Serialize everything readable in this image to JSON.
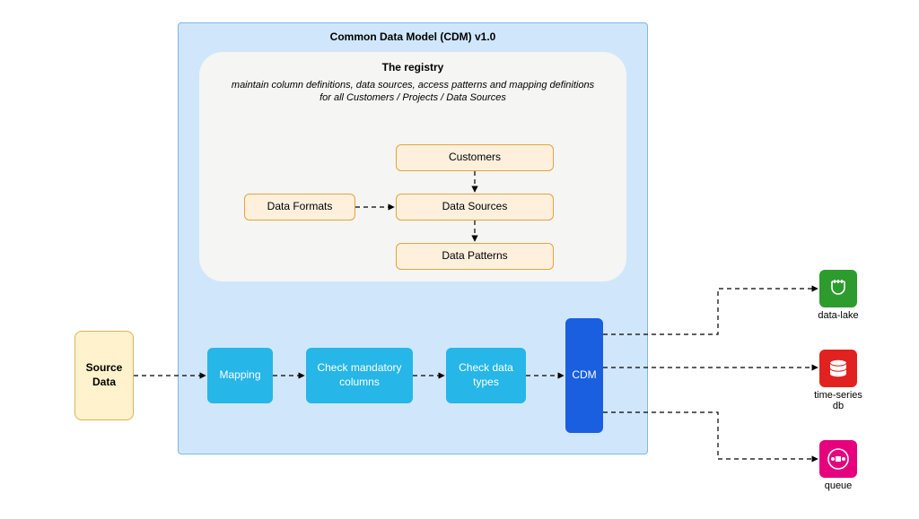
{
  "outerTitle": "Common Data Model (CDM) v1.0",
  "registry": {
    "title": "The registry",
    "subtitle": "maintain column definitions, data sources, access patterns and mapping definitions for all Customers / Projects / Data Sources",
    "customers": "Customers",
    "dataFormats": "Data Formats",
    "dataSources": "Data Sources",
    "dataPatterns": "Data Patterns"
  },
  "source": "Source Data",
  "pipeline": {
    "mapping": "Mapping",
    "checkMandatory": "Check mandatory columns",
    "checkTypes": "Check data types",
    "cdm": "CDM"
  },
  "sinks": {
    "dataLake": "data-lake",
    "tsdb": "time-series db",
    "queue": "queue"
  }
}
